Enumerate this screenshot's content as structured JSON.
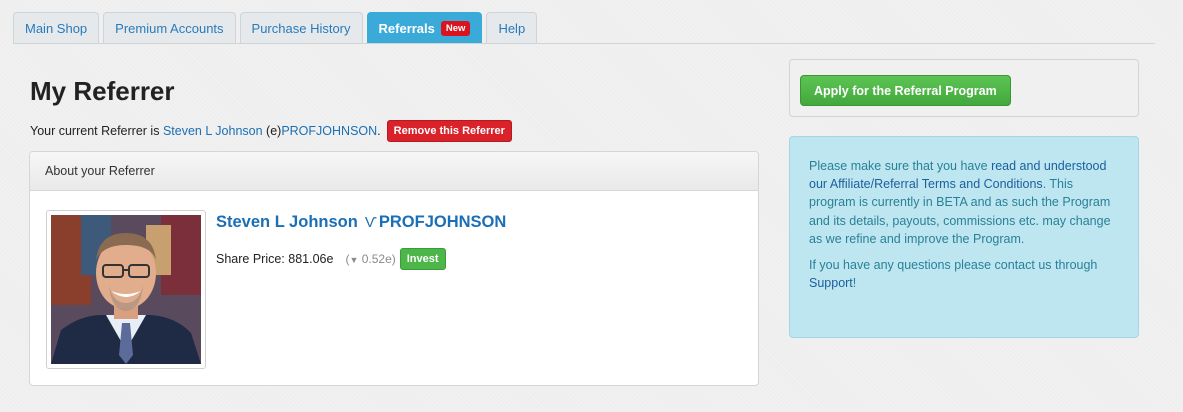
{
  "tabs": [
    {
      "label": "Main Shop",
      "active": false
    },
    {
      "label": "Premium Accounts",
      "active": false
    },
    {
      "label": "Purchase History",
      "active": false
    },
    {
      "label": "Referrals",
      "active": true,
      "badge": "New"
    },
    {
      "label": "Help",
      "active": false
    }
  ],
  "page": {
    "title": "My Referrer",
    "referrer_prefix": "Your current Referrer is",
    "referrer_name": "Steven L Johnson",
    "referrer_handle_prefix": "(e)",
    "referrer_handle": "PROFJOHNSON",
    "referrer_suffix": ".",
    "remove_button": "Remove this Referrer"
  },
  "about": {
    "header": "About your Referrer",
    "name": "Steven L Johnson",
    "handle_icon": "e-currency-icon",
    "handle": "PROFJOHNSON",
    "share_price_label": "Share Price:",
    "share_price": "881.06e",
    "change_open": "(",
    "change_arrow": "▼",
    "change_value": "0.52e",
    "change_close": ")",
    "invest_button": "Invest"
  },
  "sidebar": {
    "apply_button": "Apply for the Referral Program",
    "info_p1_before": "Please make sure that you have ",
    "info_p1_link": "read and understood our Affiliate/Referral Terms and Conditions",
    "info_p1_after": ". This program is currently in BETA and as such the Program and its details, payouts, commissions etc. may change as we refine and improve the Program.",
    "info_p2_before": "If you have any questions please contact us through ",
    "info_p2_link": "Support",
    "info_p2_after": "!"
  },
  "colors": {
    "accent_tab": "#3aaad9",
    "link": "#1a6fb5",
    "danger": "#d9222a",
    "success": "#4cb648",
    "info_bg": "#bde6f0"
  }
}
